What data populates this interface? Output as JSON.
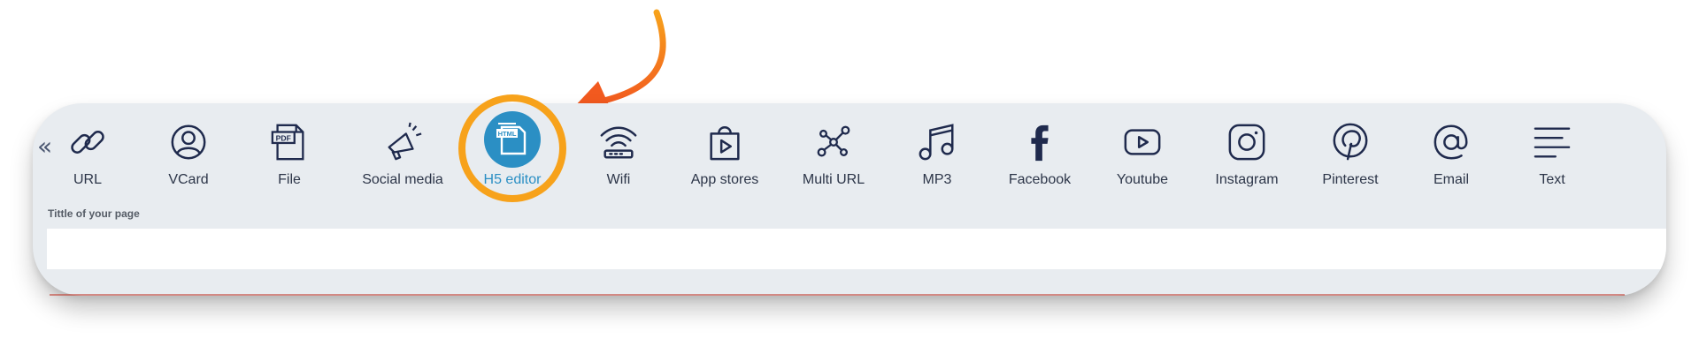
{
  "toolbar": {
    "collapse_label": "«",
    "tabs": [
      {
        "label": "URL",
        "icon": "link-icon"
      },
      {
        "label": "VCard",
        "icon": "user-circle-icon"
      },
      {
        "label": "File",
        "icon": "pdf-file-icon"
      },
      {
        "label": "Social media",
        "icon": "megaphone-icon"
      },
      {
        "label": "H5 editor",
        "icon": "html-file-icon",
        "active": true
      },
      {
        "label": "Wifi",
        "icon": "wifi-icon"
      },
      {
        "label": "App stores",
        "icon": "shopping-bag-icon"
      },
      {
        "label": "Multi URL",
        "icon": "network-nodes-icon"
      },
      {
        "label": "MP3",
        "icon": "music-note-icon"
      },
      {
        "label": "Facebook",
        "icon": "facebook-icon"
      },
      {
        "label": "Youtube",
        "icon": "youtube-icon"
      },
      {
        "label": "Instagram",
        "icon": "instagram-icon"
      },
      {
        "label": "Pinterest",
        "icon": "pinterest-icon"
      },
      {
        "label": "Email",
        "icon": "at-sign-icon"
      },
      {
        "label": "Text",
        "icon": "text-lines-icon"
      }
    ]
  },
  "form": {
    "page_title_label": "Tittle of your page",
    "page_title_value": ""
  },
  "colors": {
    "panel": "#e8ecf0",
    "icon": "#1f2a4d",
    "active": "#2b8fc4",
    "highlight": "#f7a21b",
    "arrow": "#f25a1f"
  }
}
